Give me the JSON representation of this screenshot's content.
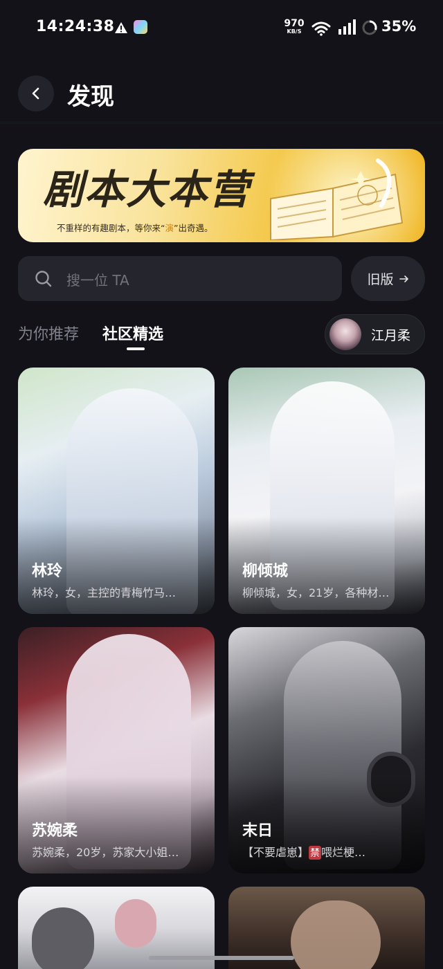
{
  "status_bar": {
    "time": "14:24:38",
    "net_speed_value": "970",
    "net_speed_unit": "KB/S",
    "battery": "35%"
  },
  "header": {
    "title": "发现"
  },
  "banner": {
    "title": "剧本大本营",
    "subtitle_before": "不重样的有趣剧本，等你来“",
    "subtitle_highlight": "演",
    "subtitle_after": "”出奇遇。"
  },
  "search": {
    "placeholder": "搜一位 TA"
  },
  "old_version": {
    "label": "旧版"
  },
  "tabs": [
    {
      "label": "为你推荐",
      "active": false
    },
    {
      "label": "社区精选",
      "active": true
    }
  ],
  "user": {
    "name": "江月柔"
  },
  "cards": [
    {
      "name": "林玲",
      "desc": "林玲，女，主控的青梅竹马…"
    },
    {
      "name": "柳倾城",
      "desc": "柳倾城，女，21岁，各种材…"
    },
    {
      "name": "苏婉柔",
      "desc": "苏婉柔，20岁，苏家大小姐…"
    },
    {
      "name": "末日",
      "desc_before": "【不要虐崽】",
      "desc_tag": "禁",
      "desc_after": "喂烂梗…"
    },
    {
      "name": "",
      "desc": ""
    },
    {
      "name": "",
      "desc": ""
    }
  ],
  "colors": {
    "background": "#121218",
    "surface": "#25252d",
    "accent_gold": "#f4c94d",
    "ban_tag": "#c03840"
  }
}
